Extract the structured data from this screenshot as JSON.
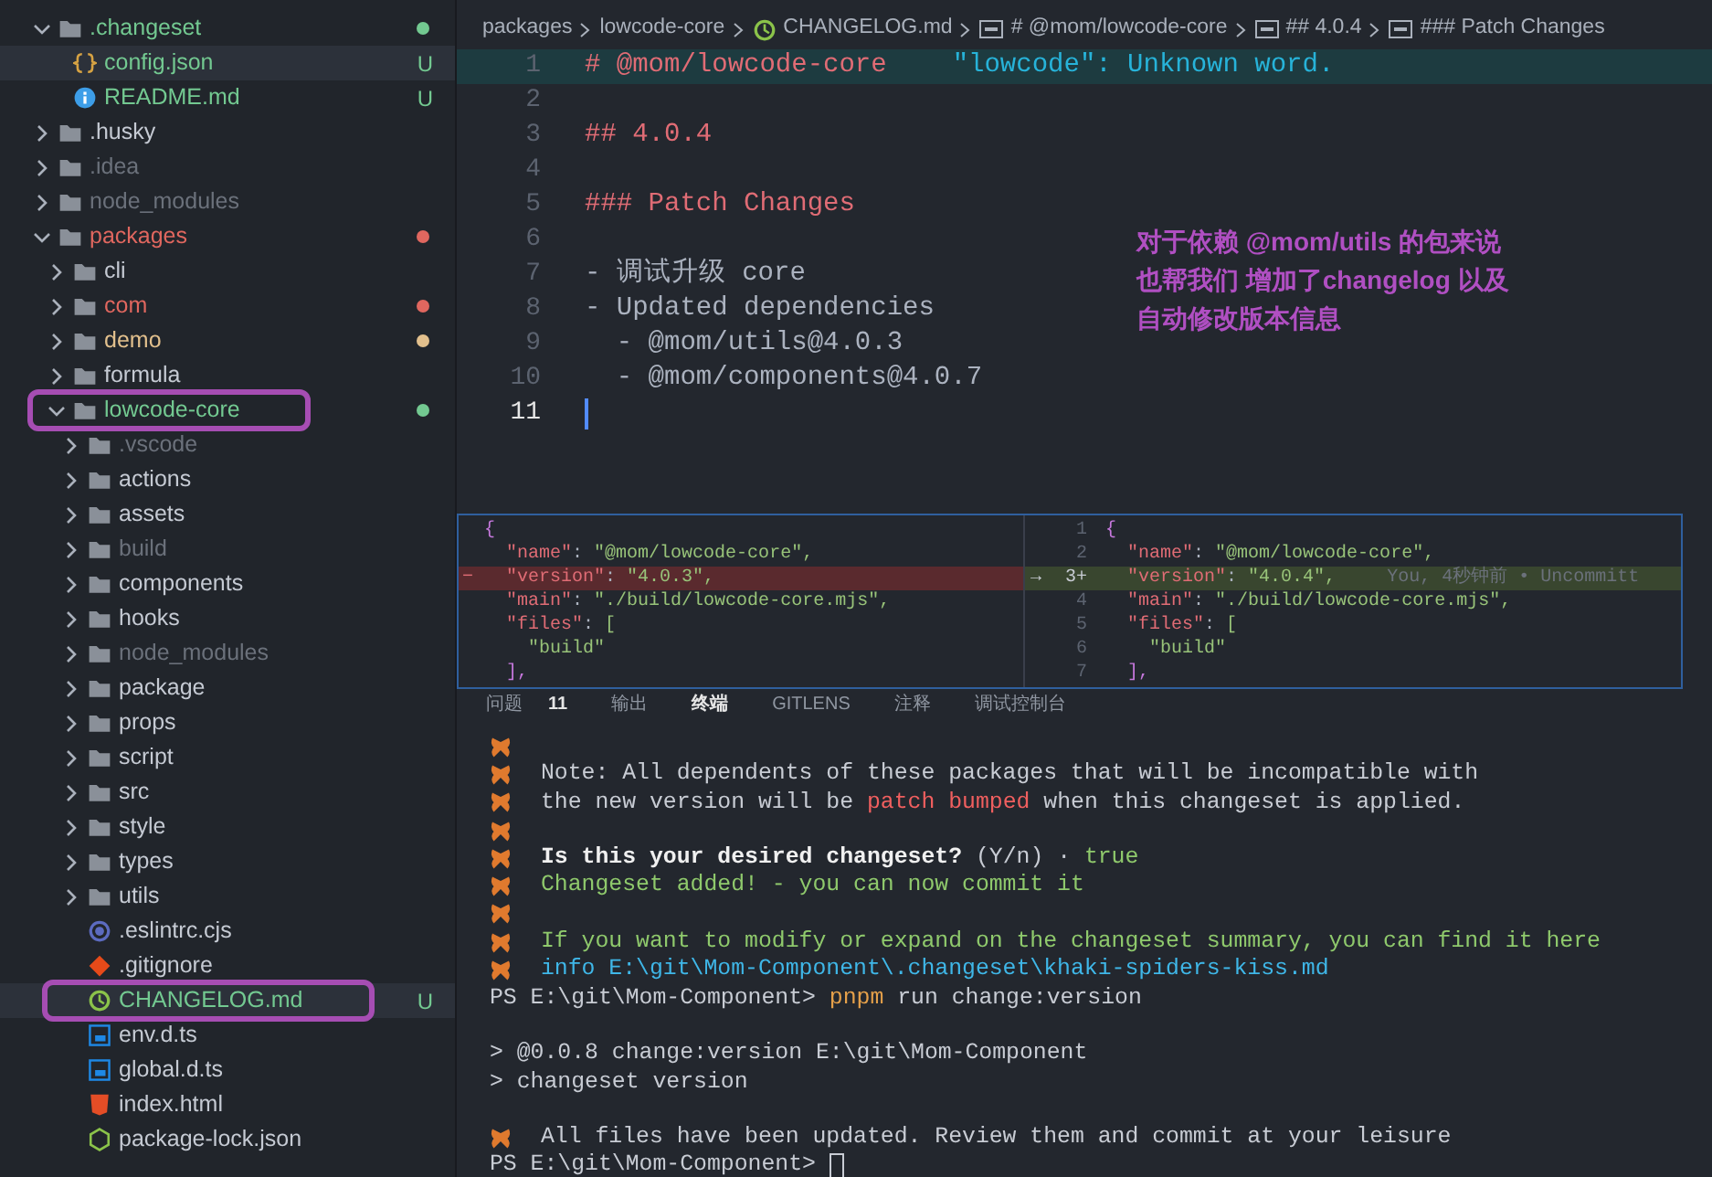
{
  "explorer": {
    "items": [
      {
        "name": ".changeset",
        "kind": "folder",
        "expanded": true,
        "color": "#73c991",
        "dot": true,
        "selected": false,
        "marked": false,
        "children": [
          {
            "name": "config.json",
            "kind": "json",
            "color": "#73c991",
            "badge": "U",
            "dot": false,
            "selected": true,
            "marked": false
          },
          {
            "name": "README.md",
            "kind": "info",
            "color": "#73c991",
            "badge": "U",
            "dot": false,
            "selected": false,
            "marked": false
          }
        ]
      },
      {
        "name": ".husky",
        "kind": "folder",
        "expanded": false,
        "color": "#c5cad3",
        "dot": false,
        "selected": false,
        "marked": false
      },
      {
        "name": ".idea",
        "kind": "folder",
        "expanded": false,
        "color": "#6b717b",
        "dot": false,
        "selected": false,
        "marked": false
      },
      {
        "name": "node_modules",
        "kind": "folder",
        "expanded": false,
        "color": "#6b717b",
        "dot": false,
        "selected": false,
        "marked": false
      },
      {
        "name": "packages",
        "kind": "folder",
        "expanded": true,
        "color": "#e0675f",
        "dot": true,
        "selected": false,
        "marked": false,
        "children": [
          {
            "name": "cli",
            "kind": "folder",
            "expanded": false,
            "color": "#c5cad3",
            "dot": false,
            "selected": false,
            "marked": false
          },
          {
            "name": "com",
            "kind": "folder",
            "expanded": false,
            "color": "#e0675f",
            "dot": true,
            "selected": false,
            "marked": false
          },
          {
            "name": "demo",
            "kind": "folder",
            "expanded": false,
            "color": "#e2c08d",
            "dot": true,
            "selected": false,
            "marked": false
          },
          {
            "name": "formula",
            "kind": "folder",
            "expanded": false,
            "color": "#c5cad3",
            "dot": false,
            "selected": false,
            "marked": false
          },
          {
            "name": "lowcode-core",
            "kind": "folder",
            "expanded": true,
            "color": "#73c991",
            "dot": true,
            "selected": false,
            "marked": true,
            "children": [
              {
                "name": ".vscode",
                "kind": "folder",
                "expanded": false,
                "color": "#6b717b",
                "dot": false,
                "selected": false,
                "marked": false
              },
              {
                "name": "actions",
                "kind": "folder",
                "expanded": false,
                "color": "#c5cad3",
                "dot": false,
                "selected": false,
                "marked": false
              },
              {
                "name": "assets",
                "kind": "folder",
                "expanded": false,
                "color": "#c5cad3",
                "dot": false,
                "selected": false,
                "marked": false
              },
              {
                "name": "build",
                "kind": "folder",
                "expanded": false,
                "color": "#6b717b",
                "dot": false,
                "selected": false,
                "marked": false
              },
              {
                "name": "components",
                "kind": "folder",
                "expanded": false,
                "color": "#c5cad3",
                "dot": false,
                "selected": false,
                "marked": false
              },
              {
                "name": "hooks",
                "kind": "folder",
                "expanded": false,
                "color": "#c5cad3",
                "dot": false,
                "selected": false,
                "marked": false
              },
              {
                "name": "node_modules",
                "kind": "folder",
                "expanded": false,
                "color": "#6b717b",
                "dot": false,
                "selected": false,
                "marked": false
              },
              {
                "name": "package",
                "kind": "folder",
                "expanded": false,
                "color": "#c5cad3",
                "dot": false,
                "selected": false,
                "marked": false
              },
              {
                "name": "props",
                "kind": "folder",
                "expanded": false,
                "color": "#c5cad3",
                "dot": false,
                "selected": false,
                "marked": false
              },
              {
                "name": "script",
                "kind": "folder",
                "expanded": false,
                "color": "#c5cad3",
                "dot": false,
                "selected": false,
                "marked": false
              },
              {
                "name": "src",
                "kind": "folder",
                "expanded": false,
                "color": "#c5cad3",
                "dot": false,
                "selected": false,
                "marked": false
              },
              {
                "name": "style",
                "kind": "folder",
                "expanded": false,
                "color": "#c5cad3",
                "dot": false,
                "selected": false,
                "marked": false
              },
              {
                "name": "types",
                "kind": "folder",
                "expanded": false,
                "color": "#c5cad3",
                "dot": false,
                "selected": false,
                "marked": false
              },
              {
                "name": "utils",
                "kind": "folder",
                "expanded": false,
                "color": "#c5cad3",
                "dot": false,
                "selected": false,
                "marked": false
              },
              {
                "name": ".eslintrc.cjs",
                "kind": "config",
                "color": "#c5cad3",
                "dot": false,
                "selected": false,
                "marked": false
              },
              {
                "name": ".gitignore",
                "kind": "git",
                "color": "#c5cad3",
                "dot": false,
                "selected": false,
                "marked": false
              },
              {
                "name": "CHANGELOG.md",
                "kind": "log",
                "color": "#73c991",
                "badge": "U",
                "dot": false,
                "selected": true,
                "marked": true
              },
              {
                "name": "env.d.ts",
                "kind": "typescript",
                "color": "#c5cad3",
                "dot": false,
                "selected": false,
                "marked": false
              },
              {
                "name": "global.d.ts",
                "kind": "typescript",
                "color": "#c5cad3",
                "dot": false,
                "selected": false,
                "marked": false
              },
              {
                "name": "index.html",
                "kind": "html",
                "color": "#c5cad3",
                "dot": false,
                "selected": false,
                "marked": false
              },
              {
                "name": "package-lock.json",
                "kind": "npm",
                "color": "#c5cad3",
                "dot": false,
                "selected": false,
                "marked": false
              }
            ]
          }
        ]
      }
    ]
  },
  "breadcrumb": [
    {
      "text": "packages",
      "kind": "folder"
    },
    {
      "text": "lowcode-core",
      "kind": "folder"
    },
    {
      "text": "CHANGELOG.md",
      "kind": "file"
    },
    {
      "text": "# @mom/lowcode-core",
      "kind": "heading"
    },
    {
      "text": "## 4.0.4",
      "kind": "heading"
    },
    {
      "text": "### Patch Changes",
      "kind": "heading"
    }
  ],
  "editor": {
    "lines": [
      {
        "number": "1",
        "text": "# @mom/lowcode-core",
        "kind": "heading",
        "hint": "\"lowcode\": Unknown word.",
        "current": false
      },
      {
        "number": "2",
        "current": false
      },
      {
        "number": "3",
        "text": "## 4.0.4",
        "kind": "heading",
        "current": false
      },
      {
        "number": "4",
        "current": false
      },
      {
        "number": "5",
        "text": "### Patch Changes",
        "kind": "heading",
        "current": false
      },
      {
        "number": "6",
        "current": false
      },
      {
        "number": "7",
        "text": "- 调试升级 core",
        "kind": "text",
        "current": false
      },
      {
        "number": "8",
        "text": "- Updated dependencies",
        "kind": "text",
        "current": false
      },
      {
        "number": "9",
        "text": "  - @mom/utils@4.0.3",
        "kind": "text",
        "current": false
      },
      {
        "number": "10",
        "text": "  - @mom/components@4.0.7",
        "kind": "text",
        "current": false
      },
      {
        "number": "11",
        "current": true
      }
    ],
    "annotation": [
      "对于依赖 @mom/utils 的包来说",
      "也帮我们 增加了changelog 以及",
      "自动修改版本信息"
    ]
  },
  "diff": {
    "left": [
      {
        "text": "{",
        "kind": "context"
      },
      {
        "text": "  \"name\": \"@mom/lowcode-core\",",
        "kind": "context"
      },
      {
        "text": "  \"version\": \"4.0.3\",",
        "kind": "removed",
        "marker": "−"
      },
      {
        "text": "  \"main\": \"./build/lowcode-core.mjs\",",
        "kind": "context"
      },
      {
        "text": "  \"files\": [",
        "kind": "context"
      },
      {
        "text": "    \"build\"",
        "kind": "context"
      },
      {
        "text": "  ],",
        "kind": "context"
      }
    ],
    "right": [
      {
        "number": "1",
        "text": "{",
        "kind": "context"
      },
      {
        "number": "2",
        "text": "  \"name\": \"@mom/lowcode-core\",",
        "kind": "context"
      },
      {
        "number": "3+",
        "text": "  \"version\": \"4.0.4\",",
        "kind": "added",
        "marker": "→",
        "blame": "You, 4秒钟前 • Uncommitt"
      },
      {
        "number": "4",
        "text": "  \"main\": \"./build/lowcode-core.mjs\",",
        "kind": "context"
      },
      {
        "number": "5",
        "text": "  \"files\": [",
        "kind": "context"
      },
      {
        "number": "6",
        "text": "    \"build\"",
        "kind": "context"
      },
      {
        "number": "7",
        "text": "  ],",
        "kind": "context"
      }
    ]
  },
  "panel_tabs": [
    {
      "label": "问题",
      "count": "11",
      "selected": false
    },
    {
      "label": "输出",
      "selected": false
    },
    {
      "label": "终端",
      "selected": true
    },
    {
      "label": "GITLENS",
      "selected": false
    },
    {
      "label": "注释",
      "selected": false
    },
    {
      "label": "调试控制台",
      "selected": false
    }
  ],
  "terminal": [
    {
      "icon": true
    },
    {
      "icon": true,
      "parts": [
        {
          "text": "Note: All dependents of these packages that will be incompatible with",
          "kind": "plain"
        }
      ]
    },
    {
      "icon": true,
      "parts": [
        {
          "text": "the new version will be ",
          "kind": "plain"
        },
        {
          "text": "patch bumped",
          "kind": "warning"
        },
        {
          "text": " when this changeset is applied.",
          "kind": "plain"
        }
      ]
    },
    {
      "icon": true
    },
    {
      "icon": true,
      "parts": [
        {
          "text": "Is this your desired changeset?",
          "kind": "question"
        },
        {
          "text": " (Y/n) · ",
          "kind": "plain"
        },
        {
          "text": "true",
          "kind": "success"
        }
      ]
    },
    {
      "icon": true,
      "parts": [
        {
          "text": "Changeset added! - you can now commit it",
          "kind": "success"
        }
      ]
    },
    {
      "icon": true
    },
    {
      "icon": true,
      "parts": [
        {
          "text": "If you want to modify or expand on the changeset summary, you can find it here",
          "kind": "success"
        }
      ]
    },
    {
      "icon": true,
      "parts": [
        {
          "text": "info E:\\git\\Mom-Component\\.changeset\\khaki-spiders-kiss.md",
          "kind": "info"
        }
      ]
    },
    {
      "icon": false,
      "parts": [
        {
          "text": "PS E:\\git\\Mom-Component> ",
          "kind": "plain"
        },
        {
          "text": "pnpm",
          "kind": "command"
        },
        {
          "text": " run change:version",
          "kind": "plain"
        }
      ]
    },
    {
      "icon": false
    },
    {
      "icon": false,
      "parts": [
        {
          "text": "> @0.0.8 change:version E:\\git\\Mom-Component",
          "kind": "plain"
        }
      ]
    },
    {
      "icon": false,
      "parts": [
        {
          "text": "> changeset version",
          "kind": "plain"
        }
      ]
    },
    {
      "icon": false
    },
    {
      "icon": true,
      "parts": [
        {
          "text": "All files have been updated. Review them and commit at your leisure",
          "kind": "plain"
        }
      ]
    },
    {
      "icon": false,
      "cursor": true,
      "parts": [
        {
          "text": "PS E:\\git\\Mom-Component> ",
          "kind": "plain"
        }
      ]
    }
  ]
}
